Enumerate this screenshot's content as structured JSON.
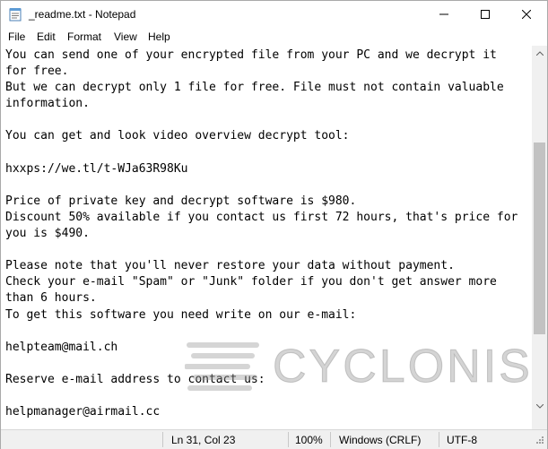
{
  "window": {
    "title": "_readme.txt - Notepad"
  },
  "menu": [
    "File",
    "Edit",
    "Format",
    "View",
    "Help"
  ],
  "content": {
    "lines": [
      "You can send one of your encrypted file from your PC and we decrypt it",
      "for free.",
      "But we can decrypt only 1 file for free. File must not contain valuable",
      "information.",
      "",
      "You can get and look video overview decrypt tool:",
      "",
      "hxxps://we.tl/t-WJa63R98Ku",
      "",
      "Price of private key and decrypt software is $980.",
      "Discount 50% available if you contact us first 72 hours, that's price for",
      "you is $490.",
      "",
      "Please note that you'll never restore your data without payment.",
      "Check your e-mail \"Spam\" or \"Junk\" folder if you don't get answer more",
      "than 6 hours.",
      "To get this software you need write on our e-mail:",
      "",
      "helpteam@mail.ch",
      "",
      "Reserve e-mail address to contact us:",
      "",
      "helpmanager@airmail.cc"
    ]
  },
  "status": {
    "position": "Ln 31, Col 23",
    "zoom": "100%",
    "line_ending": "Windows (CRLF)",
    "encoding": "UTF-8"
  },
  "scroll": {
    "thumb_position_fraction": 0.56
  },
  "watermark": {
    "text": "CYCLONIS"
  }
}
